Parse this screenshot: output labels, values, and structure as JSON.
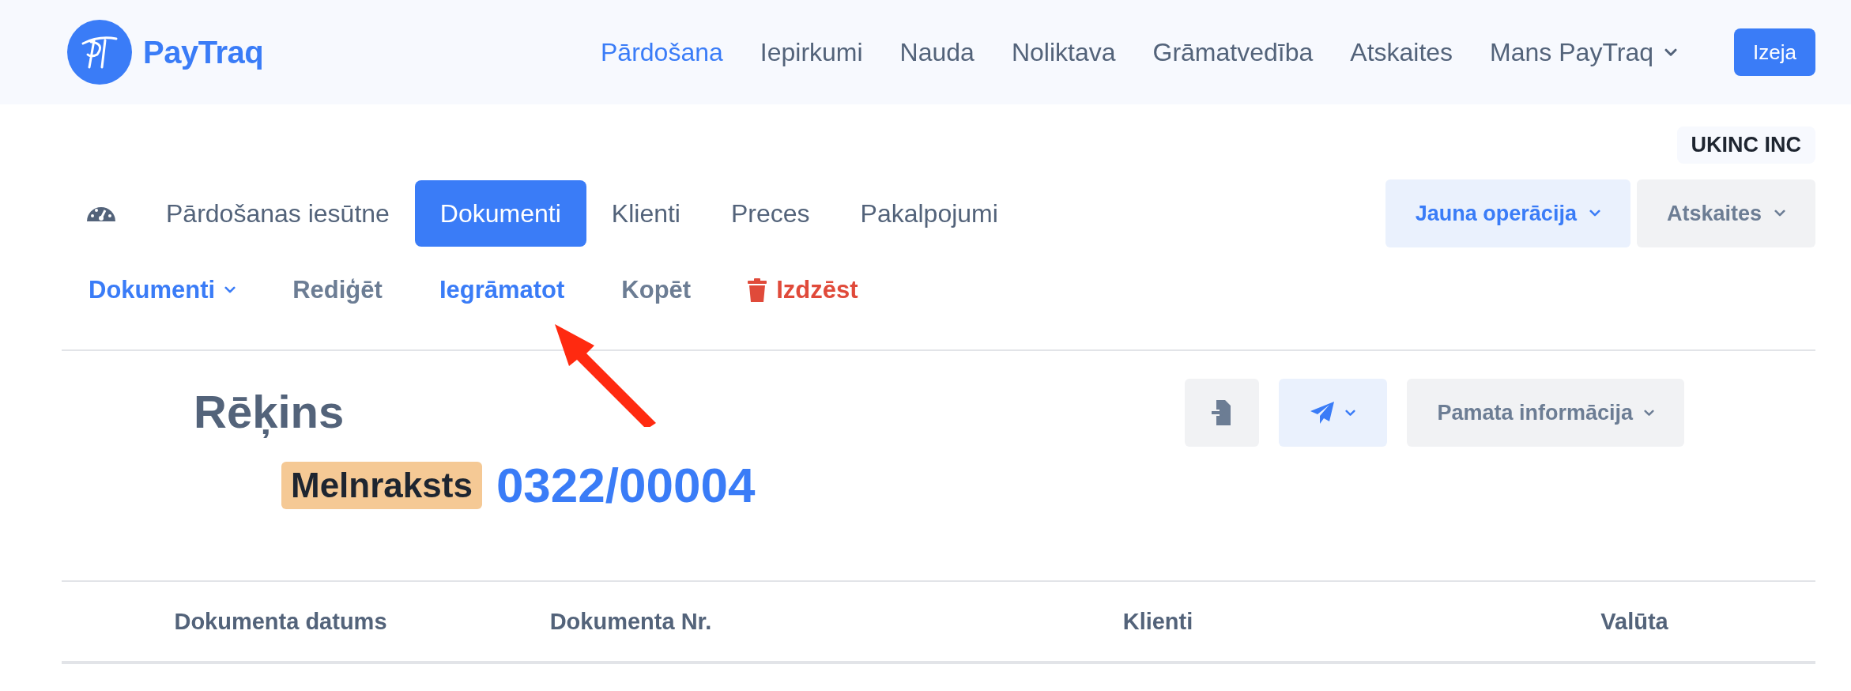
{
  "header": {
    "logo": "PayTraq",
    "nav": [
      {
        "label": "Pārdošana",
        "selected": true,
        "dropdown": false
      },
      {
        "label": "Iepirkumi",
        "selected": false,
        "dropdown": false
      },
      {
        "label": "Nauda",
        "selected": false,
        "dropdown": false
      },
      {
        "label": "Noliktava",
        "selected": false,
        "dropdown": false
      },
      {
        "label": "Grāmatvedība",
        "selected": false,
        "dropdown": false
      },
      {
        "label": "Atskaites",
        "selected": false,
        "dropdown": false
      },
      {
        "label": "Mans PayTraq",
        "selected": false,
        "dropdown": true
      }
    ],
    "exit_button": "Izeja"
  },
  "company": "UKINC INC",
  "module_tabs": [
    {
      "label": "Pārdošanas iesūtne",
      "selected": false
    },
    {
      "label": "Dokumenti",
      "selected": true
    },
    {
      "label": "Klienti",
      "selected": false
    },
    {
      "label": "Preces",
      "selected": false
    },
    {
      "label": "Pakalpojumi",
      "selected": false
    }
  ],
  "top_actions": [
    {
      "label": "Jauna operācija",
      "kind": "primary"
    },
    {
      "label": "Atskaites",
      "kind": "secondary"
    }
  ],
  "toolbar": [
    {
      "label": "Dokumenti",
      "kind": "menu"
    },
    {
      "label": "Rediģēt",
      "kind": "plain"
    },
    {
      "label": "Iegrāmatot",
      "kind": "highlight"
    },
    {
      "label": "Kopēt",
      "kind": "plain"
    },
    {
      "label": "Izdzēst",
      "kind": "danger"
    }
  ],
  "document": {
    "title": "Rēķins",
    "status": "Melnraksts",
    "number": "0322/00004"
  },
  "doc_actions": [
    {
      "kind": "import"
    },
    {
      "kind": "send"
    },
    {
      "kind": "menu",
      "label": "Pamata informācija"
    }
  ],
  "table": {
    "columns": [
      "Dokumenta datums",
      "Dokumenta Nr.",
      "Klienti",
      "Valūta"
    ]
  }
}
